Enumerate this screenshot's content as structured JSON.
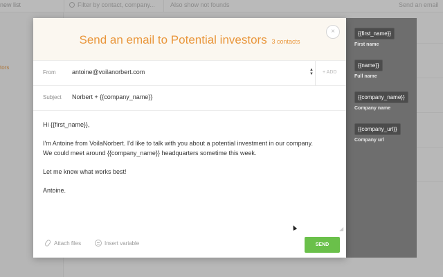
{
  "background": {
    "new_list": "new list",
    "filter_placeholder": "Filter by contact, company...",
    "also_show": "Also show not founds",
    "send_an_email": "Send an email",
    "sidebar_item": "tors"
  },
  "modal": {
    "title": "Send an email to Potential investors",
    "count": "3 contacts",
    "close_icon": "×",
    "from_label": "From",
    "from_value": "antoine@voilanorbert.com",
    "add_label": "+ ADD",
    "subject_label": "Subject",
    "subject_value": "Norbert + {{company_name}}",
    "body": {
      "greeting": "Hi {{first_name}},",
      "line1": "I'm Antoine from VoilaNorbert. I'd like to talk with you about a potential investment in our company.",
      "line2": "We could meet around {{company_name}} headquarters sometime this week.",
      "line3": "Let me know what works best!",
      "signature": "Antoine."
    },
    "attach_files": "Attach files",
    "insert_variable": "Insert variable",
    "send_label": "SEND"
  },
  "variables": [
    {
      "tag": "{{first_name}}",
      "label": "First name"
    },
    {
      "tag": "{{name}}",
      "label": "Full name"
    },
    {
      "tag": "{{company_name}}",
      "label": "Company name"
    },
    {
      "tag": "{{company_url}}",
      "label": "Company url"
    }
  ],
  "colors": {
    "accent": "#e9963b",
    "send": "#6ac04a"
  }
}
